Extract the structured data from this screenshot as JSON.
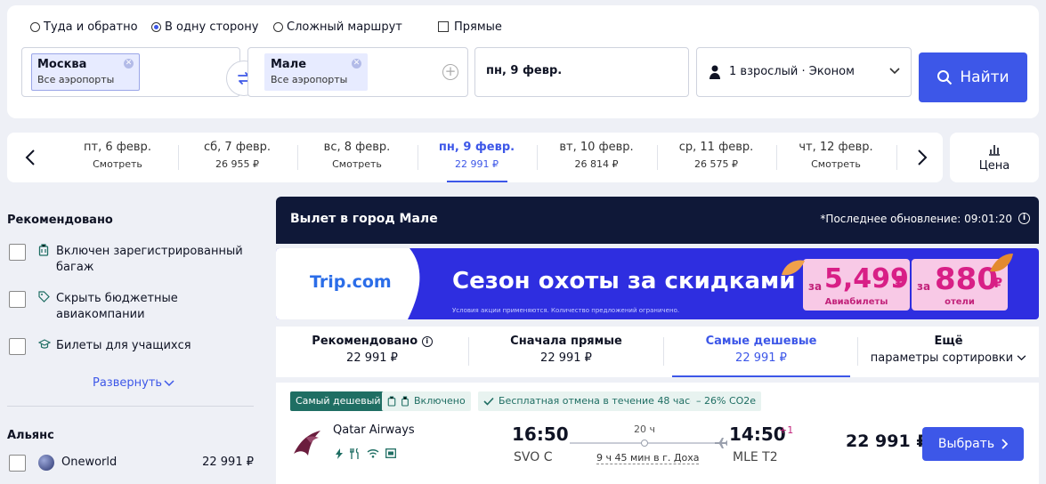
{
  "search": {
    "trip_types": [
      {
        "label": "Туда и обратно",
        "selected": false
      },
      {
        "label": "В одну сторону",
        "selected": true
      },
      {
        "label": "Сложный маршрут",
        "selected": false
      }
    ],
    "direct_label": "Прямые",
    "from": {
      "city": "Москва",
      "sub": "Все аэропорты"
    },
    "to": {
      "city": "Мале",
      "sub": "Все аэропорты"
    },
    "date": "пн, 9 февр.",
    "passengers": "1 взрослый · Эконом",
    "find_label": "Найти"
  },
  "dates": [
    {
      "day": "пт, 6 февр.",
      "price": "Смотреть",
      "active": false
    },
    {
      "day": "сб, 7 февр.",
      "price": "26 955 ₽",
      "active": false
    },
    {
      "day": "вс, 8 февр.",
      "price": "Смотреть",
      "active": false
    },
    {
      "day": "пн, 9 февр.",
      "price": "22 991 ₽",
      "active": true
    },
    {
      "day": "вт, 10 февр.",
      "price": "26 814 ₽",
      "active": false
    },
    {
      "day": "ср, 11 февр.",
      "price": "26 575 ₽",
      "active": false
    },
    {
      "day": "чт, 12 февр.",
      "price": "Смотреть",
      "active": false
    }
  ],
  "price_tab_label": "Цена",
  "sidebar": {
    "recommended_title": "Рекомендовано",
    "filters": [
      {
        "line1": "Включен зарегистрированный",
        "line2": "багаж",
        "icon": "baggage-icon"
      },
      {
        "line1": "Скрыть бюджетные",
        "line2": "авиакомпании",
        "icon": "tag-icon"
      },
      {
        "line1": "Билеты для учащихся",
        "line2": "",
        "icon": "graduation-cap-icon"
      }
    ],
    "expand_label": "Развернуть",
    "alliance_title": "Альянс",
    "alliance_name": "Oneworld",
    "alliance_price": "22 991 ₽"
  },
  "results": {
    "destination_title": "Вылет в город Мале",
    "updated": "*Последнее обновление: 09:01:20",
    "banner": {
      "logo": "Trip.com",
      "headline": "Сезон охоты за  скидками",
      "fine_print": "Условия акции применяются. Количество предложений ограничено.",
      "coupon1_prefix": "за",
      "coupon1_value": "5,499",
      "coupon1_unit": "₽",
      "coupon1_label": "Авиабилеты",
      "coupon2_prefix": "за",
      "coupon2_value": "880",
      "coupon2_unit": "₽",
      "coupon2_label": "отели"
    },
    "sort": [
      {
        "title": "Рекомендовано",
        "value": "22 991 ₽",
        "active": false
      },
      {
        "title": "Сначала прямые",
        "value": "22 991 ₽",
        "active": false
      },
      {
        "title": "Самые дешевые",
        "value": "22 991 ₽",
        "active": true
      },
      {
        "title": "Ещё",
        "value": "параметры сортировки",
        "active": false
      }
    ],
    "flight": {
      "tag_cheapest": "Самый дешевый",
      "tag_included": "Включено",
      "tag_cancel": "Бесплатная отмена в течение 48 часов",
      "tag_co2": "– 26% CO2e",
      "airline": "Qatar Airways",
      "depart_time": "16:50",
      "depart_airport": "SVO C",
      "duration": "20 ч",
      "layover": "9 ч 45 мин в г. Доха",
      "arrive_time": "14:50",
      "arrive_plus": "+1",
      "arrive_airport": "MLE T2",
      "price": "22 991 ₽",
      "select_label": "Выбрать"
    }
  },
  "colors": {
    "accent": "#3d57e8",
    "dark_bar": "#0f1838",
    "tag_green": "#1f6e63"
  }
}
